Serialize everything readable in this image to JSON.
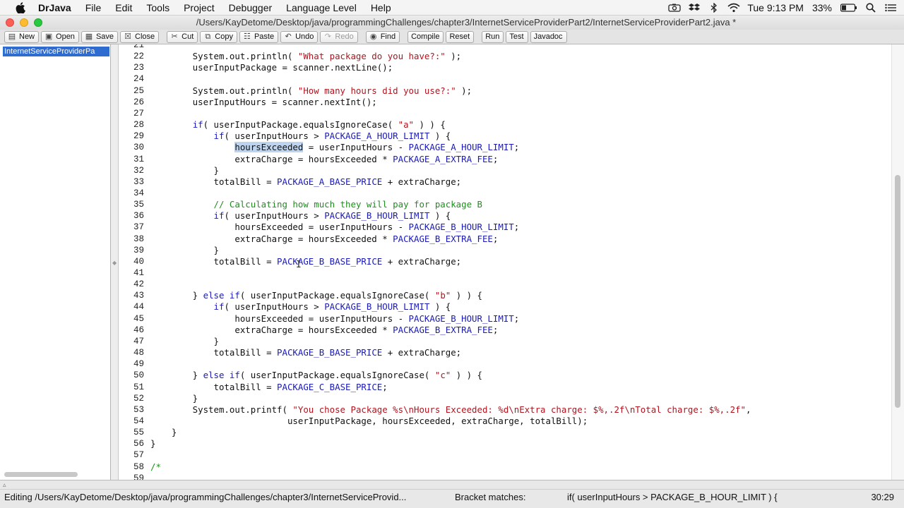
{
  "menubar": {
    "app_name": "DrJava",
    "menus": [
      "File",
      "Edit",
      "Tools",
      "Project",
      "Debugger",
      "Language Level",
      "Help"
    ],
    "clock": "Tue 9:13 PM",
    "battery": "33%",
    "icons": [
      "apple-icon",
      "camera-icon",
      "dropbox-icon",
      "bluetooth-icon",
      "wifi-icon",
      "spotlight-icon",
      "notification-center-icon"
    ]
  },
  "window": {
    "title": "/Users/KayDetome/Desktop/java/programmingChallenges/chapter3/InternetServiceProviderPart2/InternetServiceProviderPart2.java *"
  },
  "toolbar": {
    "buttons": [
      {
        "label": "New",
        "icon": "new-file-icon"
      },
      {
        "label": "Open",
        "icon": "open-folder-icon"
      },
      {
        "label": "Save",
        "icon": "save-icon"
      },
      {
        "label": "Close",
        "icon": "close-file-icon"
      },
      {
        "label": "Cut",
        "icon": "scissors-icon"
      },
      {
        "label": "Copy",
        "icon": "copy-icon"
      },
      {
        "label": "Paste",
        "icon": "paste-icon"
      },
      {
        "label": "Undo",
        "icon": "undo-icon"
      },
      {
        "label": "Redo",
        "icon": "redo-icon"
      },
      {
        "label": "Find",
        "icon": "binoculars-icon"
      },
      {
        "label": "Compile"
      },
      {
        "label": "Reset"
      },
      {
        "label": "Run"
      },
      {
        "label": "Test"
      },
      {
        "label": "Javadoc"
      }
    ]
  },
  "filepane": {
    "selected_file": "InternetServiceProviderPa"
  },
  "editor": {
    "lines": [
      {
        "n": "21",
        "text": ""
      },
      {
        "n": "22",
        "text": "        System.out.println( \"What package do you have?:\" );"
      },
      {
        "n": "23",
        "text": "        userInputPackage = scanner.nextLine();"
      },
      {
        "n": "24",
        "text": ""
      },
      {
        "n": "25",
        "text": "        System.out.println( \"How many hours did you use?:\" );"
      },
      {
        "n": "26",
        "text": "        userInputHours = scanner.nextInt();"
      },
      {
        "n": "27",
        "text": ""
      },
      {
        "n": "28",
        "text": "        if( userInputPackage.equalsIgnoreCase( \"a\" ) ) {"
      },
      {
        "n": "29",
        "text": "            if( userInputHours > PACKAGE_A_HOUR_LIMIT ) {"
      },
      {
        "n": "30",
        "text": "                hoursExceeded = userInputHours - PACKAGE_A_HOUR_LIMIT;"
      },
      {
        "n": "31",
        "text": "                extraCharge = hoursExceeded * PACKAGE_A_EXTRA_FEE;"
      },
      {
        "n": "32",
        "text": "            }"
      },
      {
        "n": "33",
        "text": "            totalBill = PACKAGE_A_BASE_PRICE + extraCharge;"
      },
      {
        "n": "34",
        "text": ""
      },
      {
        "n": "35",
        "text": "            // Calculating how much they will pay for package B"
      },
      {
        "n": "36",
        "text": "            if( userInputHours > PACKAGE_B_HOUR_LIMIT ) {"
      },
      {
        "n": "37",
        "text": "                hoursExceeded = userInputHours - PACKAGE_B_HOUR_LIMIT;"
      },
      {
        "n": "38",
        "text": "                extraCharge = hoursExceeded * PACKAGE_B_EXTRA_FEE;"
      },
      {
        "n": "39",
        "text": "            }"
      },
      {
        "n": "40",
        "text": "            totalBill = PACKAGE_B_BASE_PRICE + extraCharge;"
      },
      {
        "n": "41",
        "text": ""
      },
      {
        "n": "42",
        "text": ""
      },
      {
        "n": "43",
        "text": "        } else if( userInputPackage.equalsIgnoreCase( \"b\" ) ) {"
      },
      {
        "n": "44",
        "text": "            if( userInputHours > PACKAGE_B_HOUR_LIMIT ) {"
      },
      {
        "n": "45",
        "text": "                hoursExceeded = userInputHours - PACKAGE_B_HOUR_LIMIT;"
      },
      {
        "n": "46",
        "text": "                extraCharge = hoursExceeded * PACKAGE_B_EXTRA_FEE;"
      },
      {
        "n": "47",
        "text": "            }"
      },
      {
        "n": "48",
        "text": "            totalBill = PACKAGE_B_BASE_PRICE + extraCharge;"
      },
      {
        "n": "49",
        "text": ""
      },
      {
        "n": "50",
        "text": "        } else if( userInputPackage.equalsIgnoreCase( \"c\" ) ) {"
      },
      {
        "n": "51",
        "text": "            totalBill = PACKAGE_C_BASE_PRICE;"
      },
      {
        "n": "52",
        "text": "        }"
      },
      {
        "n": "53",
        "text": "        System.out.printf( \"You chose Package %s\\nHours Exceeded: %d\\nExtra charge: $%,.2f\\nTotal charge: $%,.2f\","
      },
      {
        "n": "54",
        "text": "                          userInputPackage, hoursExceeded, extraCharge, totalBill);"
      },
      {
        "n": "55",
        "text": "    }"
      },
      {
        "n": "56",
        "text": "}"
      },
      {
        "n": "57",
        "text": ""
      },
      {
        "n": "58",
        "text": "/*"
      },
      {
        "n": "59",
        "text": ""
      }
    ],
    "highlighted_word": "hoursExceeded"
  },
  "statusbar": {
    "editing": "Editing /Users/KayDetome/Desktop/java/programmingChallenges/chapter3/InternetServiceProvid...",
    "bracket_label": "Bracket matches:",
    "bracket_value": "if( userInputHours > PACKAGE_B_HOUR_LIMIT ) {",
    "position": "30:29"
  },
  "colors": {
    "keyword": "#1a1ab8",
    "string": "#b0141f",
    "comment": "#1e8f1e",
    "selection": "#2f6cd0",
    "highlight": "#bcd4ef"
  }
}
